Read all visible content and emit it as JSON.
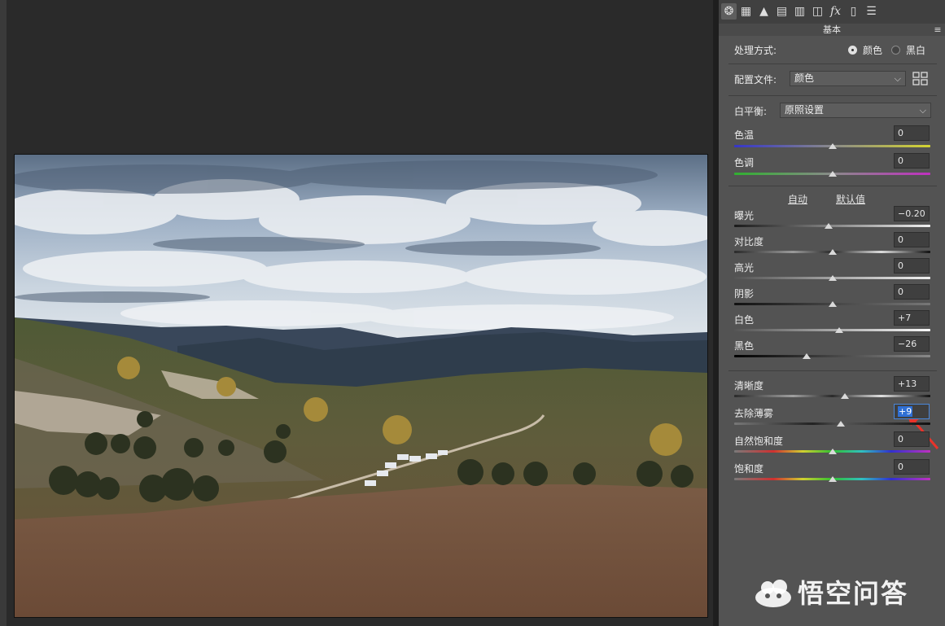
{
  "toolbar_tabs": [
    {
      "icon": "aperture-icon",
      "glyph": "❂",
      "active": true
    },
    {
      "icon": "tone-curve-icon",
      "glyph": "▦",
      "active": false
    },
    {
      "icon": "detail-icon",
      "glyph": "▲",
      "active": false
    },
    {
      "icon": "hsl-icon",
      "glyph": "▤",
      "active": false
    },
    {
      "icon": "split-toning-icon",
      "glyph": "▥",
      "active": false
    },
    {
      "icon": "lens-correction-icon",
      "glyph": "◫",
      "active": false
    },
    {
      "icon": "effects-icon",
      "glyph": "fx",
      "active": false
    },
    {
      "icon": "camera-calibration-icon",
      "glyph": "▯",
      "active": false
    },
    {
      "icon": "presets-icon",
      "glyph": "☰",
      "active": false
    }
  ],
  "section_title": "基本",
  "treatment": {
    "label": "处理方式:",
    "options": [
      {
        "label": "颜色",
        "checked": true
      },
      {
        "label": "黑白",
        "checked": false
      }
    ]
  },
  "profile": {
    "label": "配置文件:",
    "value": "颜色"
  },
  "white_balance": {
    "label": "白平衡:",
    "value": "原照设置"
  },
  "auto_label": "自动",
  "default_label": "默认值",
  "sliders": [
    {
      "key": "temp",
      "label": "色温",
      "value": "0",
      "level": 0.5
    },
    {
      "key": "tint",
      "label": "色调",
      "value": "0",
      "level": 0.5
    },
    {
      "key": "exposure",
      "label": "曝光",
      "value": "−0.20",
      "level": 0.48
    },
    {
      "key": "contrast",
      "label": "对比度",
      "value": "0",
      "level": 0.5
    },
    {
      "key": "highlights",
      "label": "高光",
      "value": "0",
      "level": 0.5
    },
    {
      "key": "shadows",
      "label": "阴影",
      "value": "0",
      "level": 0.5
    },
    {
      "key": "whites",
      "label": "白色",
      "value": "+7",
      "level": 0.535
    },
    {
      "key": "blacks",
      "label": "黑色",
      "value": "−26",
      "level": 0.37
    },
    {
      "key": "clarity",
      "label": "清晰度",
      "value": "+13",
      "level": 0.565
    },
    {
      "key": "dehaze",
      "label": "去除薄雾",
      "value": "+9",
      "level": 0.545
    },
    {
      "key": "vibrance",
      "label": "自然饱和度",
      "value": "0",
      "level": 0.5
    },
    {
      "key": "saturation",
      "label": "饱和度",
      "value": "0",
      "level": 0.5
    }
  ],
  "watermark": {
    "text": "悟空问答"
  },
  "colors": {
    "panel_bg": "#535353",
    "focus_blue": "#2f6fd4",
    "arrow_red": "#e8332a"
  }
}
